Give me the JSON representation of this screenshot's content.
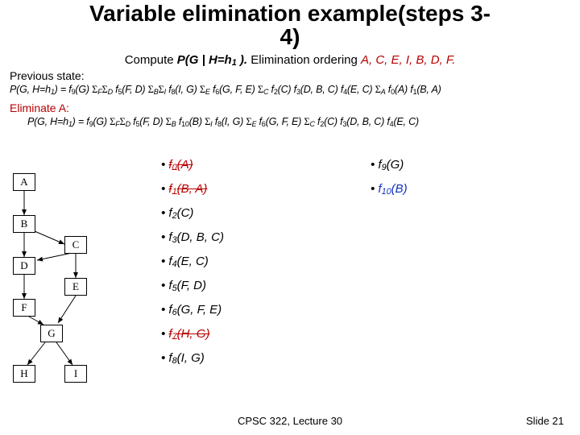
{
  "title_line1": "Variable elimination example(steps 3-",
  "title_line2": "4)",
  "subtitle_pre": "Compute ",
  "subtitle_bi": "P(G | H=h",
  "subtitle_sub1": "1",
  "subtitle_post_bi": " ).",
  "subtitle_mid": " Elimination ordering ",
  "subtitle_order": "A, C, E, I, B, D, F.",
  "prev_header": "Previous state:",
  "prev_eq_lhs": "P(G, H=h",
  "prev_eq_lhs_sub": "1",
  "prev_eq_lhs2": ") = f",
  "prev_f9": "9",
  "prev_g": "(G) ",
  "prev_sigF": "Σ",
  "prev_F": "F",
  "prev_sigD": "Σ",
  "prev_D": "D",
  "prev_f5": " f",
  "prev_f5n": "5",
  "prev_f5arg": "(F, D) ",
  "prev_sigB": "Σ",
  "prev_B": "B",
  "prev_sigI": "Σ",
  "prev_I": "I",
  "prev_f8": " f",
  "prev_f8n": "8",
  "prev_f8arg": "(I, G) ",
  "prev_sigE": "Σ",
  "prev_E": "E",
  "prev_f6": " f",
  "prev_f6n": "6",
  "prev_f6arg": "(G, F, E) ",
  "prev_sigC": "Σ",
  "prev_C": "C",
  "prev_f2": " f",
  "prev_f2n": "2",
  "prev_f2arg": "(C) f",
  "prev_f3n": "3",
  "prev_f3arg": "(D, B, C) f",
  "prev_f4n": "4",
  "prev_f4arg": "(E, C) ",
  "prev_sigA": "Σ",
  "prev_A": "A",
  "prev_f0": " f",
  "prev_f0n": "0",
  "prev_f0arg": "(A) f",
  "prev_f1n": "1",
  "prev_f1arg": "(B, A)",
  "elim_header": "Eliminate A:",
  "elim_eq_lhs": "P(G, H=h",
  "elim_eq_lhs_sub": "1",
  "elim_eq_lhs2": ") = f",
  "elim_f9": "9",
  "elim_g": "(G) ",
  "eF": "Σ",
  "eFs": "F",
  "eD": "Σ",
  "eDs": "D",
  "ef5": " f",
  "ef5n": "5",
  "ef5arg": "(F, D) ",
  "eB": "Σ",
  "eBs": "B",
  "ef10": " f",
  "ef10n": "10",
  "ef10arg": "(B) ",
  "eI": "Σ",
  "eIs": "I",
  "ef8": " f",
  "ef8n": "8",
  "ef8arg": "(I, G) ",
  "eE": "Σ",
  "eEs": "E",
  "ef6": " f",
  "ef6n": "6",
  "ef6arg": "(G, F, E) ",
  "eC": "Σ",
  "eCs": "C",
  "ef2": " f",
  "ef2n": "2",
  "ef2arg": "(C) f",
  "ef3n": "3",
  "ef3arg": "(D, B, C) f",
  "ef4n": "4",
  "ef4arg": "(E, C)",
  "nodes": {
    "A": "A",
    "B": "B",
    "C": "C",
    "D": "D",
    "E": "E",
    "F": "F",
    "G": "G",
    "H": "H",
    "I": "I"
  },
  "factors": [
    {
      "col1": "f0(A)",
      "col1_class": "red strike",
      "col2": "f9(G)",
      "col2_libclass": ""
    },
    {
      "col1": "f1(B, A)",
      "col1_class": "red strike",
      "col2": "f10(B)",
      "col2_libclass": "blue"
    },
    {
      "col1": "f2(C)",
      "col1_class": "",
      "col2": "",
      "col2_libclass": ""
    },
    {
      "col1": "f3(D, B, C)",
      "col1_class": "",
      "col2": "",
      "col2_libclass": ""
    },
    {
      "col1": "f4(E, C)",
      "col1_class": "",
      "col2": "",
      "col2_libclass": ""
    },
    {
      "col1": "f5(F, D)",
      "col1_class": "",
      "col2": "",
      "col2_libclass": ""
    },
    {
      "col1": "f6(G, F, E)",
      "col1_class": "",
      "col2": "",
      "col2_libclass": ""
    },
    {
      "col1": "f7(H, G)",
      "col1_class": "red strike",
      "col2": "",
      "col2_libclass": ""
    },
    {
      "col1": "f8(I, G)",
      "col1_class": "",
      "col2": "",
      "col2_libclass": ""
    }
  ],
  "footer_left": "CPSC 322, Lecture 30",
  "footer_right": "Slide 21"
}
